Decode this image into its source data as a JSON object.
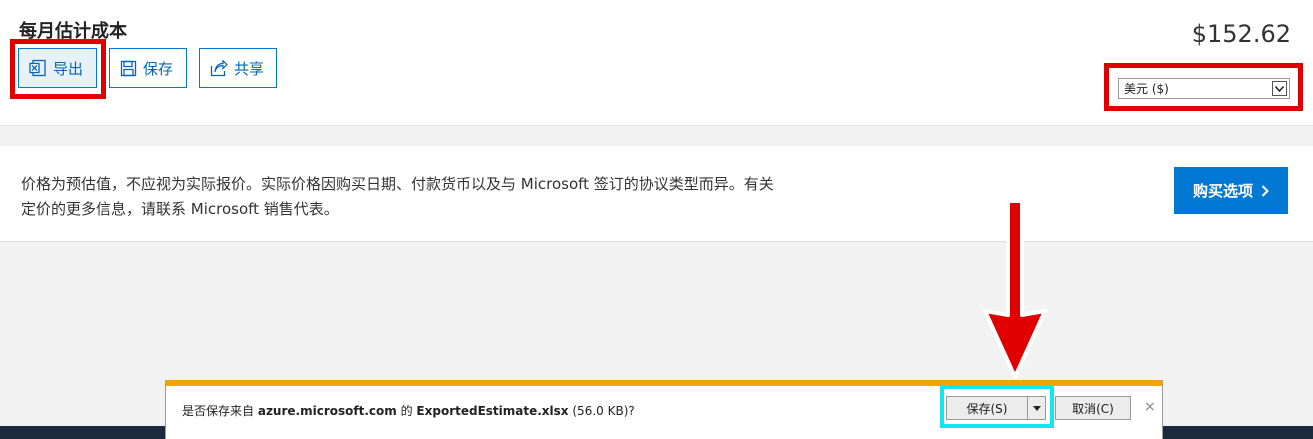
{
  "header": {
    "title": "每月估计成本",
    "total_price": "$152.62",
    "currency_selected": "美元 ($)"
  },
  "toolbar": {
    "export_label": "导出",
    "save_label": "保存",
    "share_label": "共享"
  },
  "notice": {
    "text_line1": "价格为预估值，不应视为实际报价。实际价格因购买日期、付款货币以及与 Microsoft 签订的协议类型而异。有关",
    "text_line2": "定价的更多信息，请联系 Microsoft 销售代表。",
    "buy_options_label": "购买选项"
  },
  "download_bar": {
    "prefix": "是否保存来自",
    "domain": "azure.microsoft.com",
    "middle": "的",
    "filename": "ExportedEstimate.xlsx",
    "size": "(56.0 KB)?",
    "save_label": "保存(S)",
    "cancel_label": "取消(C)",
    "close_label": "×"
  },
  "colors": {
    "accent": "#0078d4",
    "annotation_red": "#e00000",
    "annotation_cyan": "#14e6f0",
    "download_bar_accent": "#f0a30a"
  },
  "icons": [
    "excel-icon",
    "floppy-save-icon",
    "share-icon",
    "chevron-right-icon",
    "dropdown-arrow-icon",
    "close-icon"
  ]
}
